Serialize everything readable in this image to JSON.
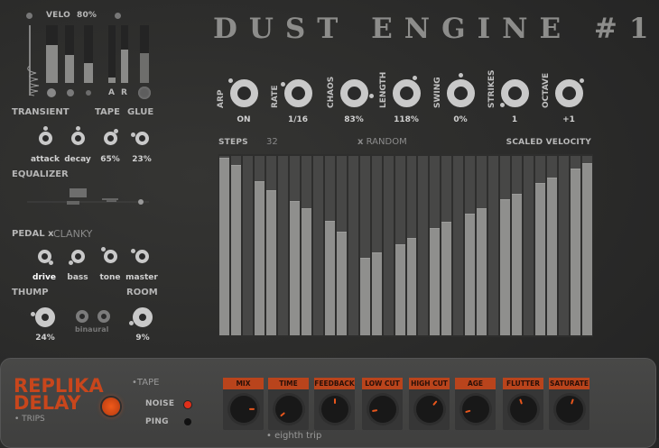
{
  "title": "DUST ENGINE #1",
  "velo": {
    "label": "VELO",
    "value": "80%",
    "bars": [
      0.66,
      0.48,
      0.34
    ],
    "attack_release": [
      0.1,
      0.58
    ],
    "glue_bar": 0.52,
    "a_label": "A",
    "r_label": "R"
  },
  "left": {
    "transient_label": "TRANSIENT",
    "tape_label": "TAPE",
    "glue_label": "GLUE",
    "knobs1": [
      {
        "label": "attack",
        "value": 0.5
      },
      {
        "label": "decay",
        "value": 0.5
      },
      {
        "label": "65%",
        "value": 0.65
      },
      {
        "label": "23%",
        "value": 0.24
      }
    ],
    "equalizer_label": "EQUALIZER",
    "pedal_label": "PEDAL",
    "pedal_x": "x",
    "pedal_type": "CLANKY",
    "knobs2": [
      {
        "label": "drive",
        "value": 1.0
      },
      {
        "label": "bass",
        "value": 0.0
      },
      {
        "label": "tone",
        "value": 0.33
      },
      {
        "label": "master",
        "value": 0.28
      }
    ],
    "thump_label": "THUMP",
    "room_label": "ROOM",
    "thump": {
      "label": "24%",
      "value": 0.22
    },
    "room": {
      "label": "9%",
      "value": 0.06
    },
    "binaural_label": "binaural"
  },
  "arp": {
    "knobs": [
      {
        "name": "ARP",
        "display": "ON",
        "value": 0.33
      },
      {
        "name": "RATE",
        "display": "1/16",
        "value": 0.28
      },
      {
        "name": "CHAOS",
        "display": "83%",
        "value": 0.87
      },
      {
        "name": "LENGTH",
        "display": "118%",
        "value": 0.61
      },
      {
        "name": "SWING",
        "display": "0%",
        "value": 0.5
      },
      {
        "name": "STRIKES",
        "display": "1",
        "value": 0.0
      },
      {
        "name": "OCTAVE",
        "display": "+1",
        "value": 0.67
      }
    ]
  },
  "steps": {
    "label": "STEPS",
    "count": "32",
    "random_x": "x",
    "random_label": "RANDOM",
    "scaled_velocity_label": "SCALED VELOCITY",
    "values": [
      0.99,
      0.95,
      0,
      0.86,
      0.81,
      0,
      0.75,
      0.71,
      0,
      0.64,
      0.58,
      0,
      0.43,
      0.46,
      0,
      0.51,
      0.545,
      0,
      0.6,
      0.635,
      0,
      0.68,
      0.71,
      0,
      0.76,
      0.79,
      0,
      0.85,
      0.88,
      0,
      0.93,
      0.96
    ]
  },
  "delay": {
    "name1": "REPLIKA",
    "name2": "DELAY",
    "trips_label": "TRIPS",
    "tape_label": "TAPE",
    "noise_label": "NOISE",
    "ping_label": "PING",
    "eighth_label": "eighth trip",
    "accent": "#c8461c",
    "knobs": [
      {
        "label": "MIX",
        "value": 0.83
      },
      {
        "label": "TIME",
        "value": 0.02
      },
      {
        "label": "FEEDBACK",
        "value": 0.5
      },
      {
        "label": "LOW CUT",
        "value": 0.13
      },
      {
        "label": "HIGH CUT",
        "value": 0.65
      },
      {
        "label": "AGE",
        "value": 0.11
      },
      {
        "label": "FLUTTER",
        "value": 0.43
      },
      {
        "label": "SATURATE",
        "value": 0.57
      }
    ]
  }
}
